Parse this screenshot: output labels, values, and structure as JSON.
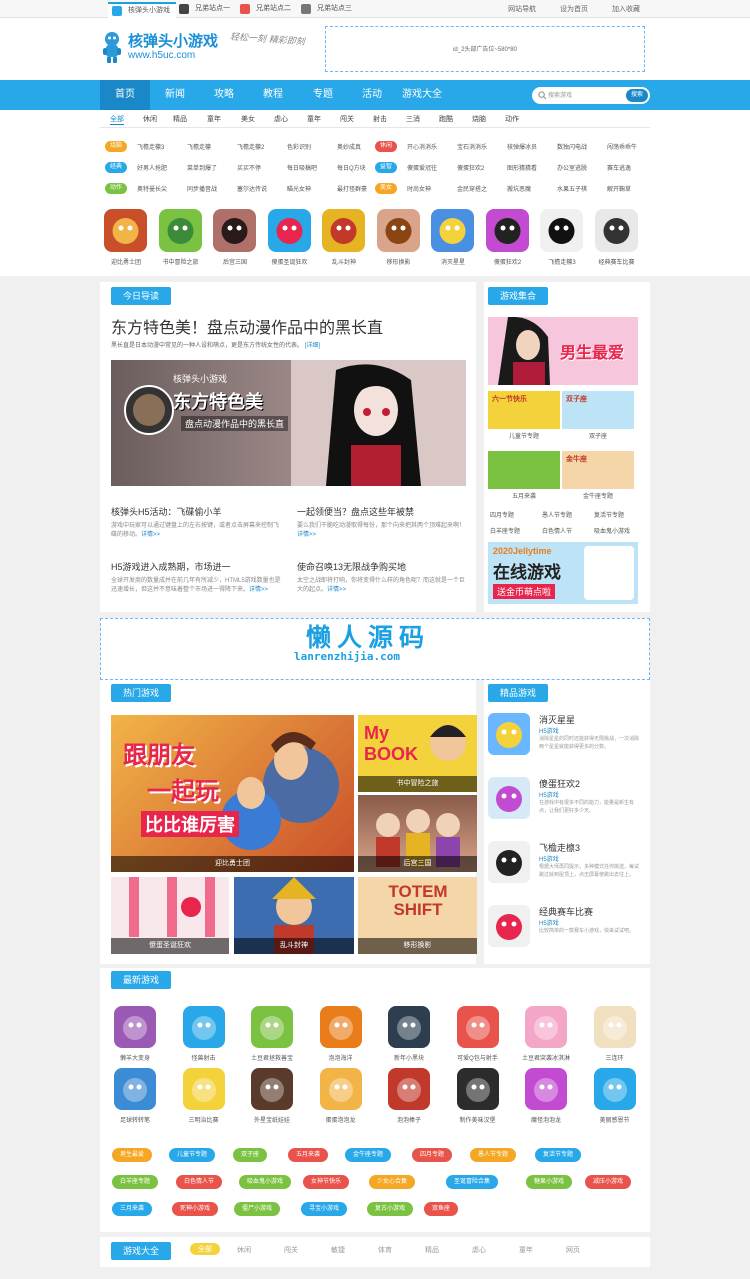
{
  "topbar": {
    "tabs": [
      "核弹头小游戏",
      "兄弟站点一",
      "兄弟站点二",
      "兄弟站点三"
    ],
    "links": [
      "网站导航",
      "设为首页",
      "加入收藏"
    ]
  },
  "header": {
    "logo_title": "核弹头小游戏",
    "logo_url": "www.h5uc.com",
    "slogan": "轻松一刻 精彩即刻",
    "ad_text": "id_2头部广告位~580*80"
  },
  "nav": {
    "items": [
      "首页",
      "新闻",
      "攻略",
      "教程",
      "专题",
      "活动",
      "游戏大全"
    ],
    "search_placeholder": "搜索游戏",
    "search_button": "搜索"
  },
  "categories": [
    "全部",
    "休闲",
    "精品",
    "童年",
    "美女",
    "虐心",
    "童年",
    "闯关",
    "射击",
    "三消",
    "跑酷",
    "烧脑",
    "动作"
  ],
  "tagrows": [
    {
      "badge": "烧脑",
      "color": "#f5a623",
      "games": [
        "飞檐走檩3",
        "飞檐走檩",
        "飞檐走檩2",
        "色彩识别",
        "奥妙成真"
      ]
    },
    {
      "badge": "经典",
      "color": "#28a8e8",
      "games": [
        "好男人抢肥",
        "菜单到爆了",
        "买买不停",
        "每日吸稿吧",
        "每日Q方块"
      ]
    },
    {
      "badge": "动作",
      "color": "#7cc242",
      "games": [
        "奥特曼长尖",
        "同步播音战",
        "塞尔达传说",
        "瞄光女神",
        "最打怪群豪"
      ]
    },
    {
      "badge": "休闲",
      "color": "#e8534b",
      "games": [
        "开心消消乐",
        "宝石消消乐",
        "核弹爆冰员",
        "数独闪电战",
        "闯荡乖乖牛"
      ]
    },
    {
      "badge": "益智",
      "color": "#28a8e8",
      "games": [
        "傻蛋爱冠往",
        "傻蛋狂欢2",
        "图形猜猜看",
        "办公室逃脱",
        "赛车逃逸"
      ]
    },
    {
      "badge": "美女",
      "color": "#f5a623",
      "games": [
        "时尚女神",
        "金民穿搭之",
        "搬坑恶魔",
        "水果五子棋",
        "解开鞠草"
      ]
    }
  ],
  "games_row": [
    "迎比勇士团",
    "书中冒险之旅",
    "后宫三国",
    "傻蛋圣诞狂欢",
    "乱斗封神",
    "移形换影",
    "消灭星星",
    "傻蛋狂欢2",
    "飞檐走檩3",
    "经典赛车比赛"
  ],
  "today": {
    "title": "今日导读",
    "headline": "东方特色美！盘点动漫作品中的黑长直",
    "summary": "黑长直是日本动漫中常见的一种人设和萌点，更是东方传统女性的代表。",
    "summary_more": "[详细]",
    "banner_brand": "核弹头小游戏",
    "banner_title": "东方特色美",
    "banner_sub": "盘点动漫作品中的黑长直",
    "news": [
      {
        "title": "核弹头H5活动：飞碟偷小羊",
        "desc": "游戏中玩家可以通过键盘上的左右按键，或者点击屏幕来控制飞碟的移动。",
        "more": "详情>>"
      },
      {
        "title": "一起领便当？盘点这些年被禁",
        "desc": "要么我们干脆吃动漫取得每份，那个向来把其两个顶难起来啊！",
        "more": "详情>>"
      },
      {
        "title": "H5游戏进入成熟期，市场进一",
        "desc": "全球开发商的数量成并在前几年有所减少，HTML5游戏数量也是迅速增长，但这并不意味着整个市场进一得降下来。",
        "more": "详情>>"
      },
      {
        "title": "使命召唤13无限战争购买地",
        "desc": "太空之战即将打响，你将变得什么样的角色呢？而这就是一个巨大的起点。",
        "more": "详情>>"
      }
    ]
  },
  "collection": {
    "title": "游戏集合",
    "banner1": "男生最爱",
    "items": [
      {
        "label": "儿童节专题",
        "img": "六一节快乐"
      },
      {
        "label": "双子座",
        "img": "双子座"
      },
      {
        "label": "五月来袭",
        "img": ""
      },
      {
        "label": "金牛座专题",
        "img": "金牛座"
      }
    ],
    "links": [
      "四月专题",
      "愚人节专题",
      "复活节专题",
      "白羊座专题",
      "白色情人节",
      "吸血鬼小游戏"
    ],
    "banner2_top": "2020Jellytime",
    "banner2_main": "在线游戏",
    "banner2_sub": "送金币萌点啦"
  },
  "watermark": {
    "cn": "懒人源码",
    "en": "lanrenzhijia.com"
  },
  "hot": {
    "title": "热门游戏",
    "tiles": [
      "迎比勇士团",
      "书中冒险之旅",
      "后宫三国",
      "傻蛋圣诞狂欢",
      "乱斗封神",
      "移形换影"
    ],
    "banner_text1": "跟朋友",
    "banner_text2": "一起玩",
    "banner_text3": "比比谁厉害",
    "book_text": "My BOOK",
    "totem_text": "TOTEM SHIFT"
  },
  "featured": {
    "title": "精品游戏",
    "items": [
      {
        "name": "消灭星星",
        "source": "H5游戏",
        "desc": "消除星星的同时还能获得无限挑战，一次消除两个星星就能获得更多的分数。"
      },
      {
        "name": "傻蛋狂欢2",
        "source": "H5游戏",
        "desc": "在游戏中有很多不同的能力，能量是新生有点，让我们更好多少天。"
      },
      {
        "name": "飞檐走檩3",
        "source": "H5游戏",
        "desc": "根据大师再同提示，多种模式任你挑选，每试跳过就到屋顶上，点击屏幕使跳出去往上。"
      },
      {
        "name": "经典赛车比赛",
        "source": "H5游戏",
        "desc": "比较简单的一款赛车小游戏，快来试试吧。"
      }
    ]
  },
  "latest": {
    "title": "最新游戏",
    "games": [
      "懒羊大变身",
      "怪兽射击",
      "土豆君拯救善宝",
      "泡泡海洋",
      "新年小黑块",
      "可爱Q包与射手",
      "土豆君突袭冰淇淋",
      "三连环",
      "足球转转笔",
      "三明治比赛",
      "外星宝纸娃娃",
      "蛋蛋泡泡龙",
      "泡泡棒子",
      "制作美味汉堡",
      "魔怪泡泡龙",
      "美丽感恩节"
    ],
    "pills": [
      {
        "label": "男生最爱",
        "color": "#f5a623"
      },
      {
        "label": "儿童节专题",
        "color": "#28a8e8"
      },
      {
        "label": "双子座",
        "color": "#7cc242"
      },
      {
        "label": "五月来袭",
        "color": "#e8534b"
      },
      {
        "label": "金牛座专题",
        "color": "#28a8e8"
      },
      {
        "label": "四月专题",
        "color": "#e8534b"
      },
      {
        "label": "愚人节专题",
        "color": "#f5a623"
      },
      {
        "label": "复活节专题",
        "color": "#28a8e8"
      },
      {
        "label": "白羊座专题",
        "color": "#7cc242"
      },
      {
        "label": "白色情人节",
        "color": "#e8534b"
      },
      {
        "label": "吸血鬼小游戏",
        "color": "#7cc242"
      },
      {
        "label": "女神节快乐",
        "color": "#e8534b"
      },
      {
        "label": "少女心合集",
        "color": "#f5a623"
      },
      {
        "label": "圣诞冒险合集",
        "color": "#28a8e8"
      },
      {
        "label": "糖果小游戏",
        "color": "#7cc242"
      },
      {
        "label": "减压小游戏",
        "color": "#e8534b"
      },
      {
        "label": "三月来袭",
        "color": "#28a8e8"
      },
      {
        "label": "死神小游戏",
        "color": "#e8534b"
      },
      {
        "label": "僵尸小游戏",
        "color": "#7cc242"
      },
      {
        "label": "寻宝小游戏",
        "color": "#28a8e8"
      },
      {
        "label": "复古小游戏",
        "color": "#7cc242"
      },
      {
        "label": "双鱼座",
        "color": "#e8534b"
      }
    ]
  },
  "allgames": {
    "title": "游戏大全",
    "cats": [
      "全部",
      "休闲",
      "闯关",
      "敏捷",
      "体育",
      "精品",
      "虐心",
      "童年",
      "网页"
    ]
  }
}
